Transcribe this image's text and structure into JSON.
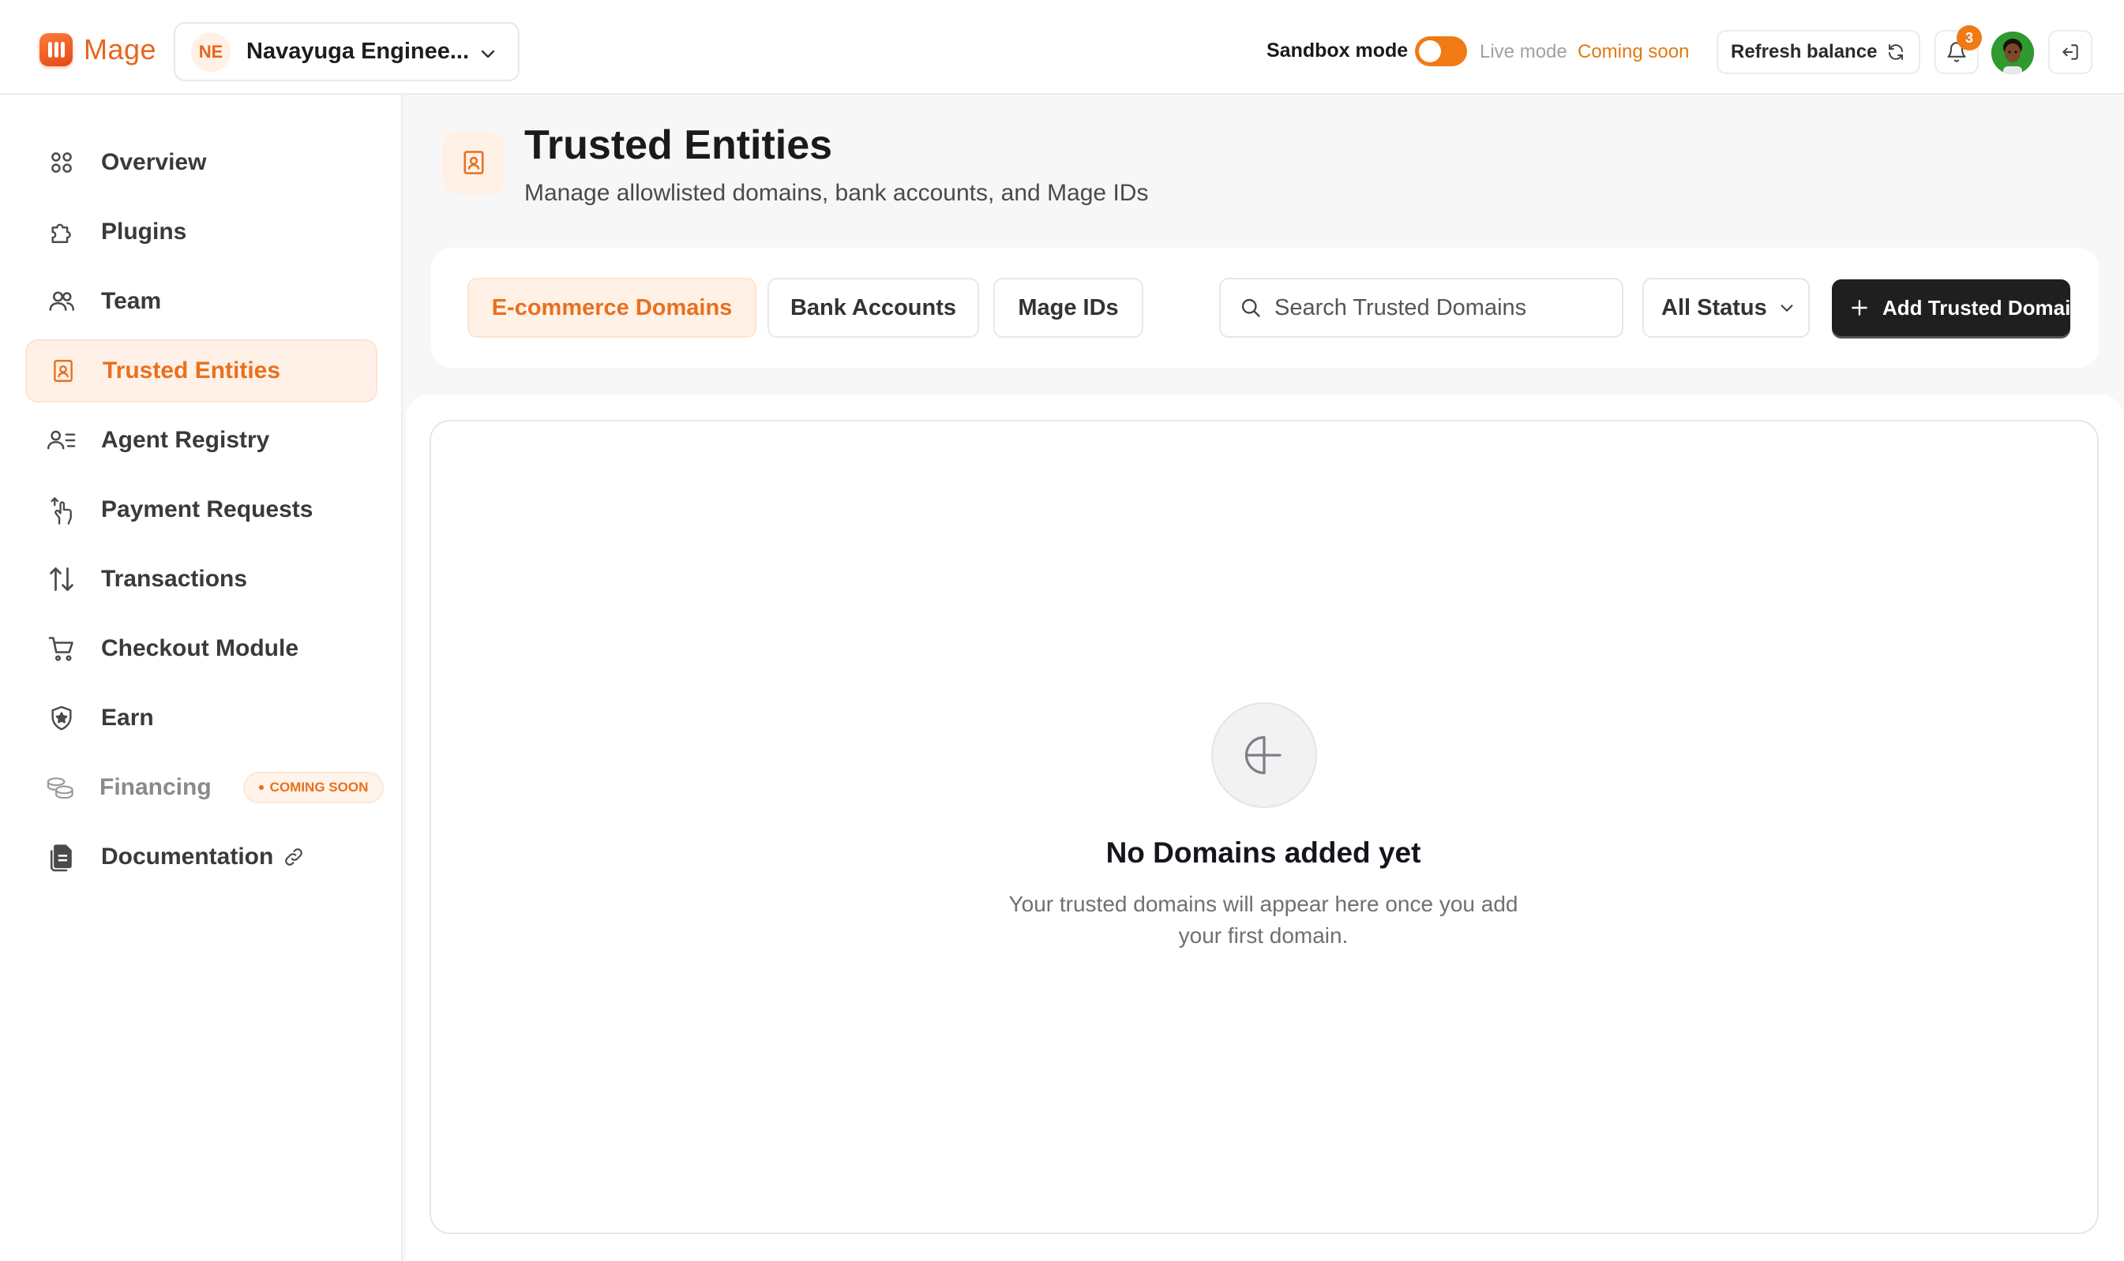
{
  "app": {
    "brand": "Mage",
    "colors": {
      "accent": "#e8701e",
      "toggle_on": "#f07a14",
      "primary_button": "#1f1f1f"
    }
  },
  "header": {
    "org": {
      "initials": "NE",
      "name": "Navayuga Enginee..."
    },
    "sandbox_label": "Sandbox mode",
    "sandbox_enabled": true,
    "live_label": "Live mode",
    "coming_soon_label": "Coming soon",
    "refresh_label": "Refresh balance",
    "notification_count": "3",
    "icons": [
      "chevron-down-icon",
      "refresh-icon",
      "bell-icon",
      "avatar",
      "logout-icon"
    ]
  },
  "sidebar": {
    "items": [
      {
        "label": "Overview",
        "icon": "grid-icon"
      },
      {
        "label": "Plugins",
        "icon": "puzzle-icon"
      },
      {
        "label": "Team",
        "icon": "users-icon"
      },
      {
        "label": "Trusted Entities",
        "icon": "contact-card-icon",
        "active": true
      },
      {
        "label": "Agent Registry",
        "icon": "user-list-icon"
      },
      {
        "label": "Payment Requests",
        "icon": "hand-request-icon"
      },
      {
        "label": "Transactions",
        "icon": "arrows-up-down-icon"
      },
      {
        "label": "Checkout Module",
        "icon": "cart-icon"
      },
      {
        "label": "Earn",
        "icon": "shield-star-icon"
      },
      {
        "label": "Financing",
        "icon": "coins-icon",
        "badge": "COMING SOON"
      },
      {
        "label": "Documentation",
        "icon": "document-icon"
      }
    ]
  },
  "page": {
    "title": "Trusted Entities",
    "subtitle": "Manage allowlisted domains, bank accounts, and Mage IDs"
  },
  "toolbar": {
    "tabs": [
      {
        "label": "E-commerce Domains",
        "active": true
      },
      {
        "label": "Bank Accounts"
      },
      {
        "label": "Mage IDs"
      }
    ],
    "search_placeholder": "Search Trusted Domains",
    "status_filter": "All Status",
    "add_label": "Add Trusted Domain"
  },
  "empty_state": {
    "title": "No Domains added yet",
    "description": "Your trusted domains will appear here once you add your first domain."
  }
}
